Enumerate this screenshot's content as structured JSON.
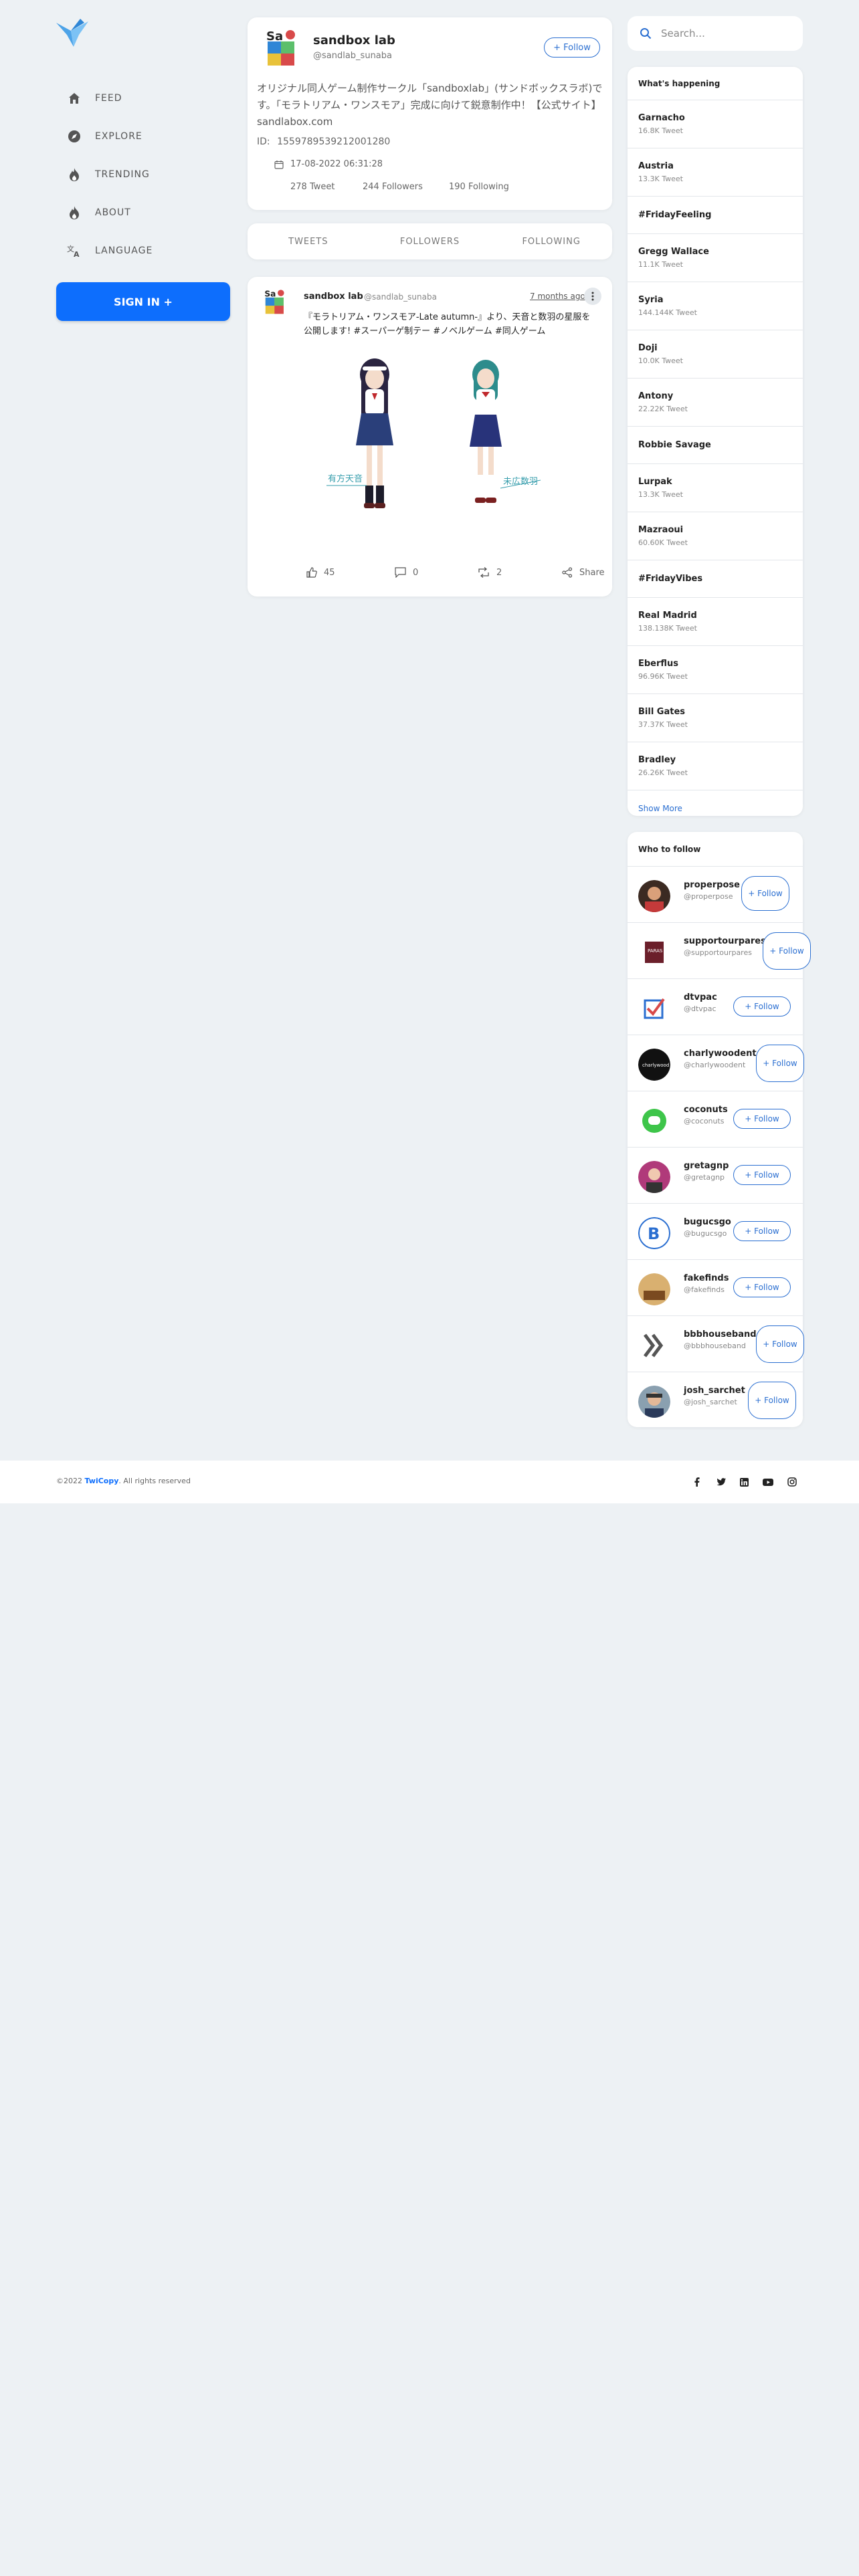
{
  "colors": {
    "brand": "#0d6efd",
    "link": "#2b6fd1",
    "background": "#edf1f4"
  },
  "nav": [
    {
      "label": "FEED",
      "icon": "home-icon"
    },
    {
      "label": "EXPLORE",
      "icon": "compass-icon"
    },
    {
      "label": "TRENDING",
      "icon": "fire-icon"
    },
    {
      "label": "ABOUT",
      "icon": "fire-icon"
    },
    {
      "label": "LANGUAGE",
      "icon": "translate-icon"
    }
  ],
  "signin_label": "SIGN IN +",
  "profile": {
    "name": "sandbox lab",
    "handle": "@sandlab_sunaba",
    "follow_label": "+ Follow",
    "bio": "オリジナル同人ゲーム制作サークル「sandboxlab」(サンドボックスラボ)です。「モラトリアム・ワンスモア」完成に向けて鋭意制作中！【公式サイト】sandlabox.com",
    "id_label": "ID:",
    "id_value": "1559789539212001280",
    "joined": "17-08-2022 06:31:28",
    "tweets": "278 Tweet",
    "followers": "244 Followers",
    "following": "190 Following"
  },
  "tabs": [
    "TWEETS",
    "FOLLOWERS",
    "FOLLOWING"
  ],
  "tweet": {
    "name": "sandbox lab",
    "handle": "@sandlab_sunaba",
    "time": "7 months ago",
    "text": "『モラトリアム・ワンスモア-Late autumn-』より、天音と数羽の星服を公開します! #スーパーゲ制テー #ノベルゲーム #同人ゲーム",
    "likes": "45",
    "comments": "0",
    "retweets": "2",
    "share_label": "Share"
  },
  "search_placeholder": "Search...",
  "trends": {
    "title": "What's happening",
    "items": [
      {
        "name": "Garnacho",
        "count": "16.8K Tweet"
      },
      {
        "name": "Austria",
        "count": "13.3K Tweet"
      },
      {
        "name": "#FridayFeeling",
        "count": ""
      },
      {
        "name": "Gregg Wallace",
        "count": "11.1K Tweet"
      },
      {
        "name": "Syria",
        "count": "144.144K Tweet"
      },
      {
        "name": "Doji",
        "count": "10.0K Tweet"
      },
      {
        "name": "Antony",
        "count": "22.22K Tweet"
      },
      {
        "name": "Robbie Savage",
        "count": ""
      },
      {
        "name": "Lurpak",
        "count": "13.3K Tweet"
      },
      {
        "name": "Mazraoui",
        "count": "60.60K Tweet"
      },
      {
        "name": "#FridayVibes",
        "count": ""
      },
      {
        "name": "Real Madrid",
        "count": "138.138K Tweet"
      },
      {
        "name": "Eberflus",
        "count": "96.96K Tweet"
      },
      {
        "name": "Bill Gates",
        "count": "37.37K Tweet"
      },
      {
        "name": "Bradley",
        "count": "26.26K Tweet"
      }
    ],
    "show_more": "Show More"
  },
  "who_to_follow": {
    "title": "Who to follow",
    "follow_label": "+ Follow",
    "users": [
      {
        "name": "properpose",
        "handle": "@properpose"
      },
      {
        "name": "supportourpares",
        "handle": "@supportourpares"
      },
      {
        "name": "dtvpac",
        "handle": "@dtvpac"
      },
      {
        "name": "charlywoodent",
        "handle": "@charlywoodent"
      },
      {
        "name": "coconuts",
        "handle": "@coconuts"
      },
      {
        "name": "gretagnp",
        "handle": "@gretagnp"
      },
      {
        "name": "bugucsgo",
        "handle": "@bugucsgo"
      },
      {
        "name": "fakefinds",
        "handle": "@fakefinds"
      },
      {
        "name": "bbbhouseband",
        "handle": "@bbbhouseband"
      },
      {
        "name": "josh_sarchet",
        "handle": "@josh_sarchet"
      }
    ]
  },
  "footer": {
    "copy_prefix": "©2022",
    "brand": "TwiCopy",
    "copy_suffix": ". All rights reserved"
  }
}
